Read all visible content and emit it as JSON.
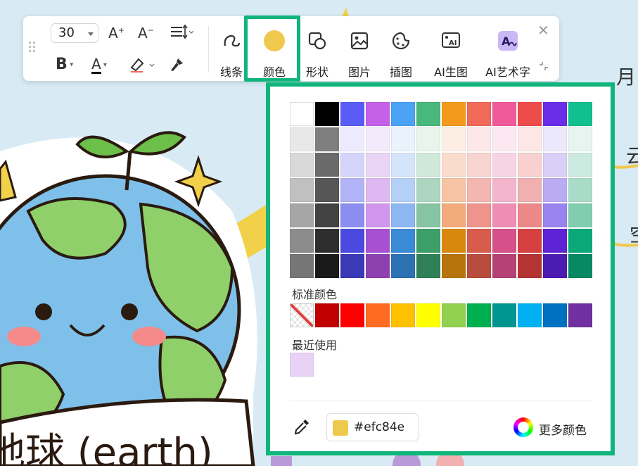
{
  "toolbar": {
    "font_size": "30",
    "increase_font": "A",
    "decrease_font": "A",
    "bold": "B",
    "font_color": "A",
    "tools": [
      {
        "id": "line",
        "label": "线条"
      },
      {
        "id": "color",
        "label": "颜色"
      },
      {
        "id": "shape",
        "label": "形状"
      },
      {
        "id": "image",
        "label": "图片"
      },
      {
        "id": "illustration",
        "label": "插图"
      },
      {
        "id": "ai_image",
        "label": "AI生图"
      },
      {
        "id": "ai_art",
        "label": "AI艺术字"
      }
    ],
    "close_icon": "close-icon"
  },
  "color_panel": {
    "grid": [
      [
        "#ffffff",
        "#000000",
        "#5a5cf7",
        "#c560e8",
        "#4aa3f5",
        "#48b87c",
        "#f39a1c",
        "#f06a5a",
        "#f05a9a",
        "#ee4b4b",
        "#6a2ee8",
        "#10c08f"
      ],
      [
        "#e8e8e8",
        "#7f7f7f",
        "#eceafc",
        "#f5eafb",
        "#eaf2fc",
        "#e8f4ec",
        "#fdeee4",
        "#fce8e8",
        "#fce8f0",
        "#fce6e6",
        "#ece8fb",
        "#e6f5ef"
      ],
      [
        "#d8d8d8",
        "#6a6a6a",
        "#d4d4fa",
        "#ead4f6",
        "#d4e4fa",
        "#cfe8da",
        "#fadbcc",
        "#f8d4d0",
        "#f8d4e2",
        "#f8d0d0",
        "#d8d0f7",
        "#cdeae0"
      ],
      [
        "#c0c0c0",
        "#565656",
        "#b2b2f6",
        "#deb8f2",
        "#b4d0f6",
        "#acd6bf",
        "#f6c4a4",
        "#f3b6b0",
        "#f3b4cc",
        "#f1b0b0",
        "#b9acf2",
        "#a9dcc8"
      ],
      [
        "#a6a6a6",
        "#424242",
        "#8c8cf1",
        "#d096ed",
        "#8cb7f2",
        "#86c4a3",
        "#f2ab7a",
        "#ee948c",
        "#ee8eb4",
        "#ec8888",
        "#9884ee",
        "#80cdb0"
      ],
      [
        "#8c8c8c",
        "#2e2e2e",
        "#4a4ae0",
        "#a850d2",
        "#3a8ad6",
        "#3c9e68",
        "#d8880f",
        "#d85c4c",
        "#d6508a",
        "#d64040",
        "#5c24d4",
        "#0aa87a"
      ],
      [
        "#767676",
        "#1a1a1a",
        "#3a3ab6",
        "#8e40b0",
        "#2e72b4",
        "#2f8056",
        "#b8740c",
        "#b84c3e",
        "#b44274",
        "#b43434",
        "#4c1cb2",
        "#078a64"
      ]
    ],
    "standard_label": "标准颜色",
    "standard": [
      "none",
      "#c00000",
      "#ff0000",
      "#ff6b23",
      "#ffc000",
      "#ffff00",
      "#92d050",
      "#00b050",
      "#00968f",
      "#00b0f0",
      "#0070c0",
      "#7030a0"
    ],
    "recent_label": "最近使用",
    "recent": [
      "#e8d3f6"
    ],
    "current_hex": "#efc84e",
    "current_color": "#efc84e",
    "more_colors": "更多颜色",
    "accent_color": "#0fb57a"
  },
  "canvas": {
    "right_texts": [
      "月",
      "云",
      "空"
    ],
    "bottom_text": "地球 (earth)"
  }
}
